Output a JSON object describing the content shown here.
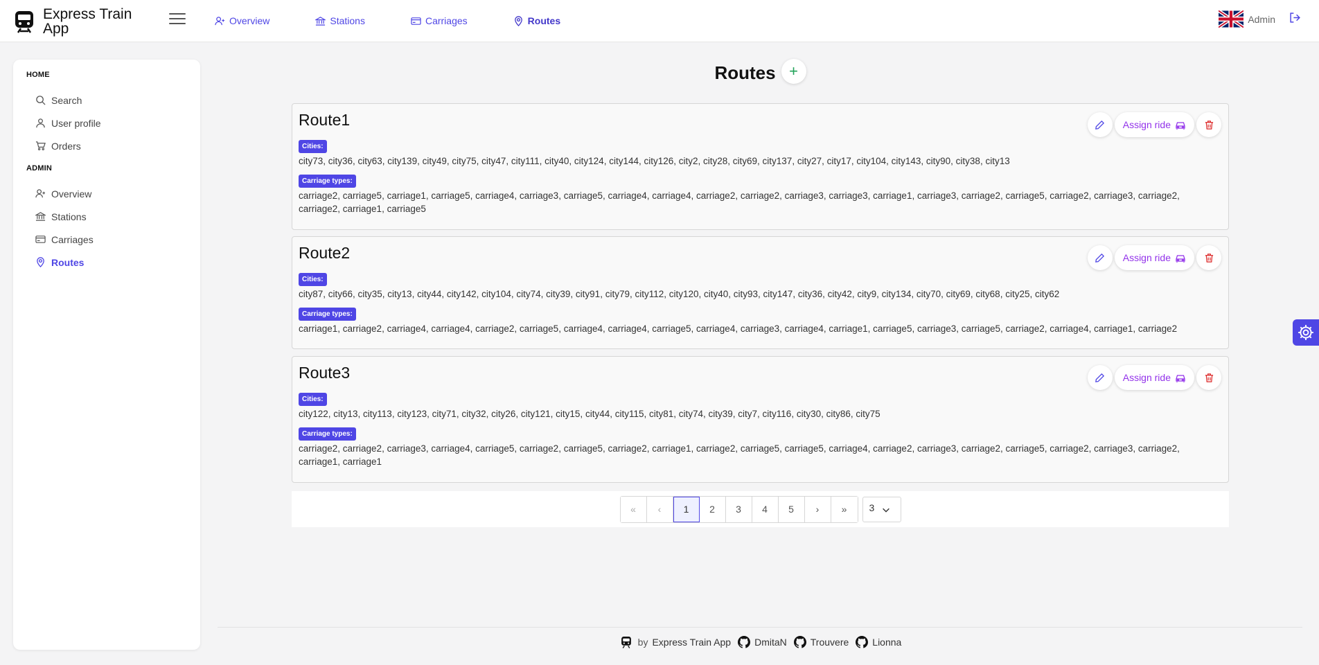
{
  "app": {
    "title": "Express Train App"
  },
  "topnav": [
    {
      "label": "Overview",
      "icon": "user-plus-icon"
    },
    {
      "label": "Stations",
      "icon": "bank-icon"
    },
    {
      "label": "Carriages",
      "icon": "card-icon"
    },
    {
      "label": "Routes",
      "icon": "map-pin-icon",
      "active": true
    }
  ],
  "user": {
    "name": "Admin",
    "language_flag": "uk-flag-icon"
  },
  "sidebar": {
    "home_heading": "HOME",
    "home_items": [
      {
        "label": "Search",
        "icon": "search-icon"
      },
      {
        "label": "User profile",
        "icon": "user-icon"
      },
      {
        "label": "Orders",
        "icon": "cart-icon"
      }
    ],
    "admin_heading": "ADMIN",
    "admin_items": [
      {
        "label": "Overview",
        "icon": "user-plus-icon"
      },
      {
        "label": "Stations",
        "icon": "bank-icon"
      },
      {
        "label": "Carriages",
        "icon": "card-icon"
      },
      {
        "label": "Routes",
        "icon": "map-pin-icon",
        "active": true
      }
    ]
  },
  "main": {
    "title": "Routes",
    "add_label": "+",
    "cities_label": "Cities:",
    "carriage_label": "Carriage types:",
    "assign_label": "Assign ride",
    "routes": [
      {
        "name": "Route1",
        "cities": "city73, city36, city63, city139, city49, city75, city47, city111, city40, city124, city144, city126, city2, city28, city69, city137, city27, city17, city104, city143, city90, city38, city13",
        "carriages": "carriage2, carriage5, carriage1, carriage5, carriage4, carriage3, carriage5, carriage4, carriage4, carriage2, carriage2, carriage3, carriage3, carriage1, carriage3, carriage2, carriage5, carriage2, carriage3, carriage2, carriage2, carriage1, carriage5"
      },
      {
        "name": "Route2",
        "cities": "city87, city66, city35, city13, city44, city142, city104, city74, city39, city91, city79, city112, city120, city40, city93, city147, city36, city42, city9, city134, city70, city69, city68, city25, city62",
        "carriages": "carriage1, carriage2, carriage4, carriage4, carriage2, carriage5, carriage4, carriage4, carriage5, carriage4, carriage3, carriage4, carriage1, carriage5, carriage3, carriage5, carriage2, carriage4, carriage1, carriage2"
      },
      {
        "name": "Route3",
        "cities": "city122, city13, city113, city123, city71, city32, city26, city121, city15, city44, city115, city81, city74, city39, city7, city116, city30, city86, city75",
        "carriages": "carriage2, carriage2, carriage3, carriage4, carriage5, carriage2, carriage5, carriage2, carriage1, carriage2, carriage5, carriage5, carriage4, carriage2, carriage3, carriage2, carriage5, carriage2, carriage3, carriage2, carriage1, carriage1"
      }
    ]
  },
  "pagination": {
    "first": "«",
    "prev": "‹",
    "pages": [
      "1",
      "2",
      "3",
      "4",
      "5"
    ],
    "current_page": "1",
    "next": "›",
    "last": "»",
    "page_size": "3"
  },
  "footer": {
    "by": "by",
    "app_link": "Express Train App",
    "authors": [
      "DmitaN",
      "Trouvere",
      "Lionna"
    ]
  },
  "colors": {
    "accent": "#4f46e5",
    "assign": "#9333ea",
    "delete": "#dc2626",
    "add": "#22a35a"
  }
}
